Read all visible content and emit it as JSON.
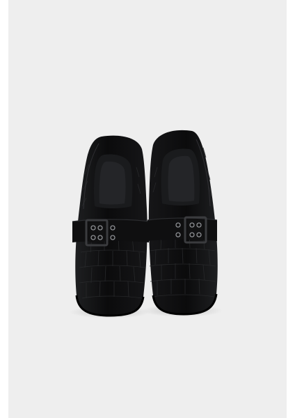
{
  "image": {
    "subject": "product-photo-black-croc-embossed-loafers",
    "colors": {
      "frame": "#ffffff",
      "backdrop": "#eeeeee",
      "leather": "#0c0c0d",
      "leather_highlight": "#2a2b2d",
      "lining": "#1a1b1d",
      "buckle": "#3a3b3e",
      "eyelet": "#8e9094"
    }
  }
}
